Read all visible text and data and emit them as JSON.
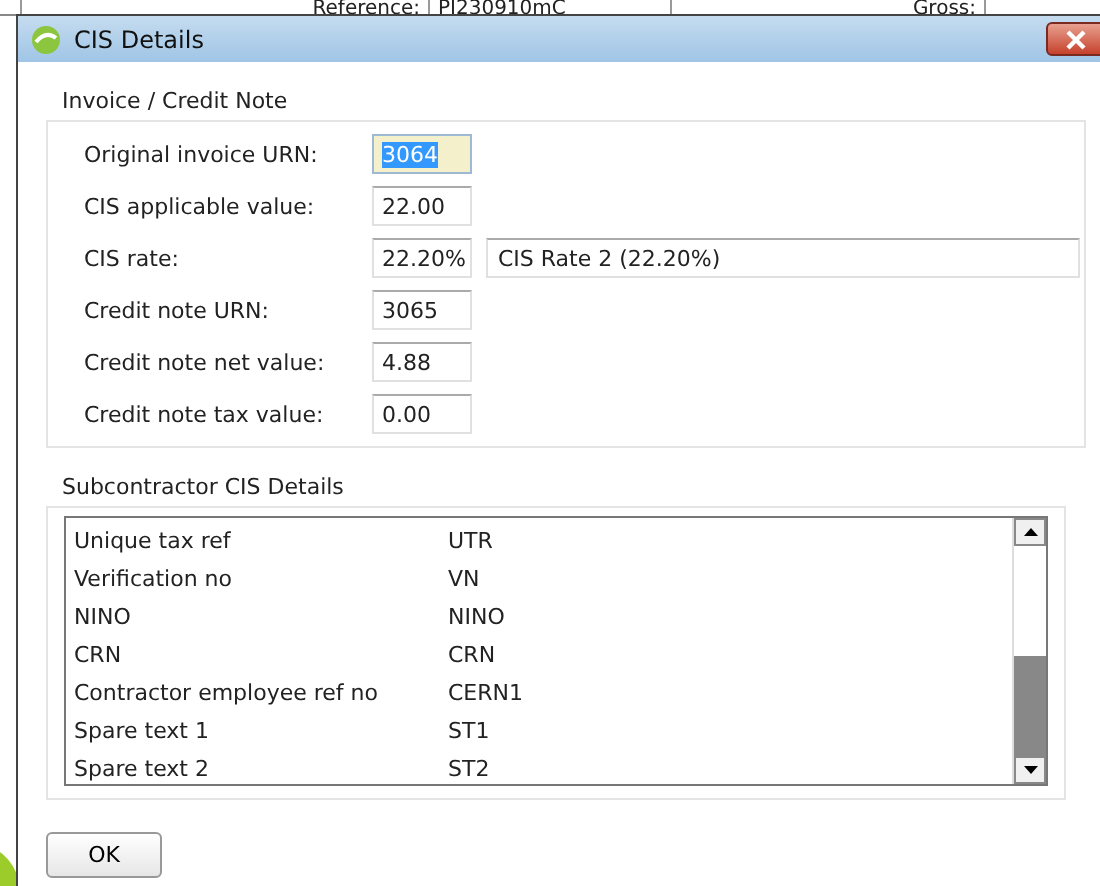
{
  "background_window": {
    "cells": [
      "Reference:",
      "PI230910mC",
      "Gross:"
    ]
  },
  "window": {
    "title": "CIS Details"
  },
  "invoice_group": {
    "title": "Invoice / Credit Note",
    "fields": [
      {
        "label": "Original invoice URN:",
        "value": "3064",
        "focused": true
      },
      {
        "label": "CIS applicable value:",
        "value": "22.00",
        "focused": false
      },
      {
        "label": "CIS rate:",
        "value": "22.20%",
        "focused": false,
        "description": "CIS Rate 2 (22.20%)"
      },
      {
        "label": "Credit note URN:",
        "value": "3065",
        "focused": false
      },
      {
        "label": "Credit note net value:",
        "value": "4.88",
        "focused": false
      },
      {
        "label": "Credit note tax value:",
        "value": "0.00",
        "focused": false
      }
    ]
  },
  "subcontractor_group": {
    "title": "Subcontractor CIS Details",
    "rows": [
      {
        "name": "Unique tax ref",
        "value": "UTR"
      },
      {
        "name": "Verification no",
        "value": "VN"
      },
      {
        "name": "NINO",
        "value": "NINO"
      },
      {
        "name": "CRN",
        "value": "CRN"
      },
      {
        "name": "Contractor employee ref no",
        "value": "CERN1"
      },
      {
        "name": "Spare text 1",
        "value": "ST1"
      },
      {
        "name": "Spare text 2",
        "value": "ST2"
      }
    ]
  },
  "buttons": [
    "OK"
  ]
}
